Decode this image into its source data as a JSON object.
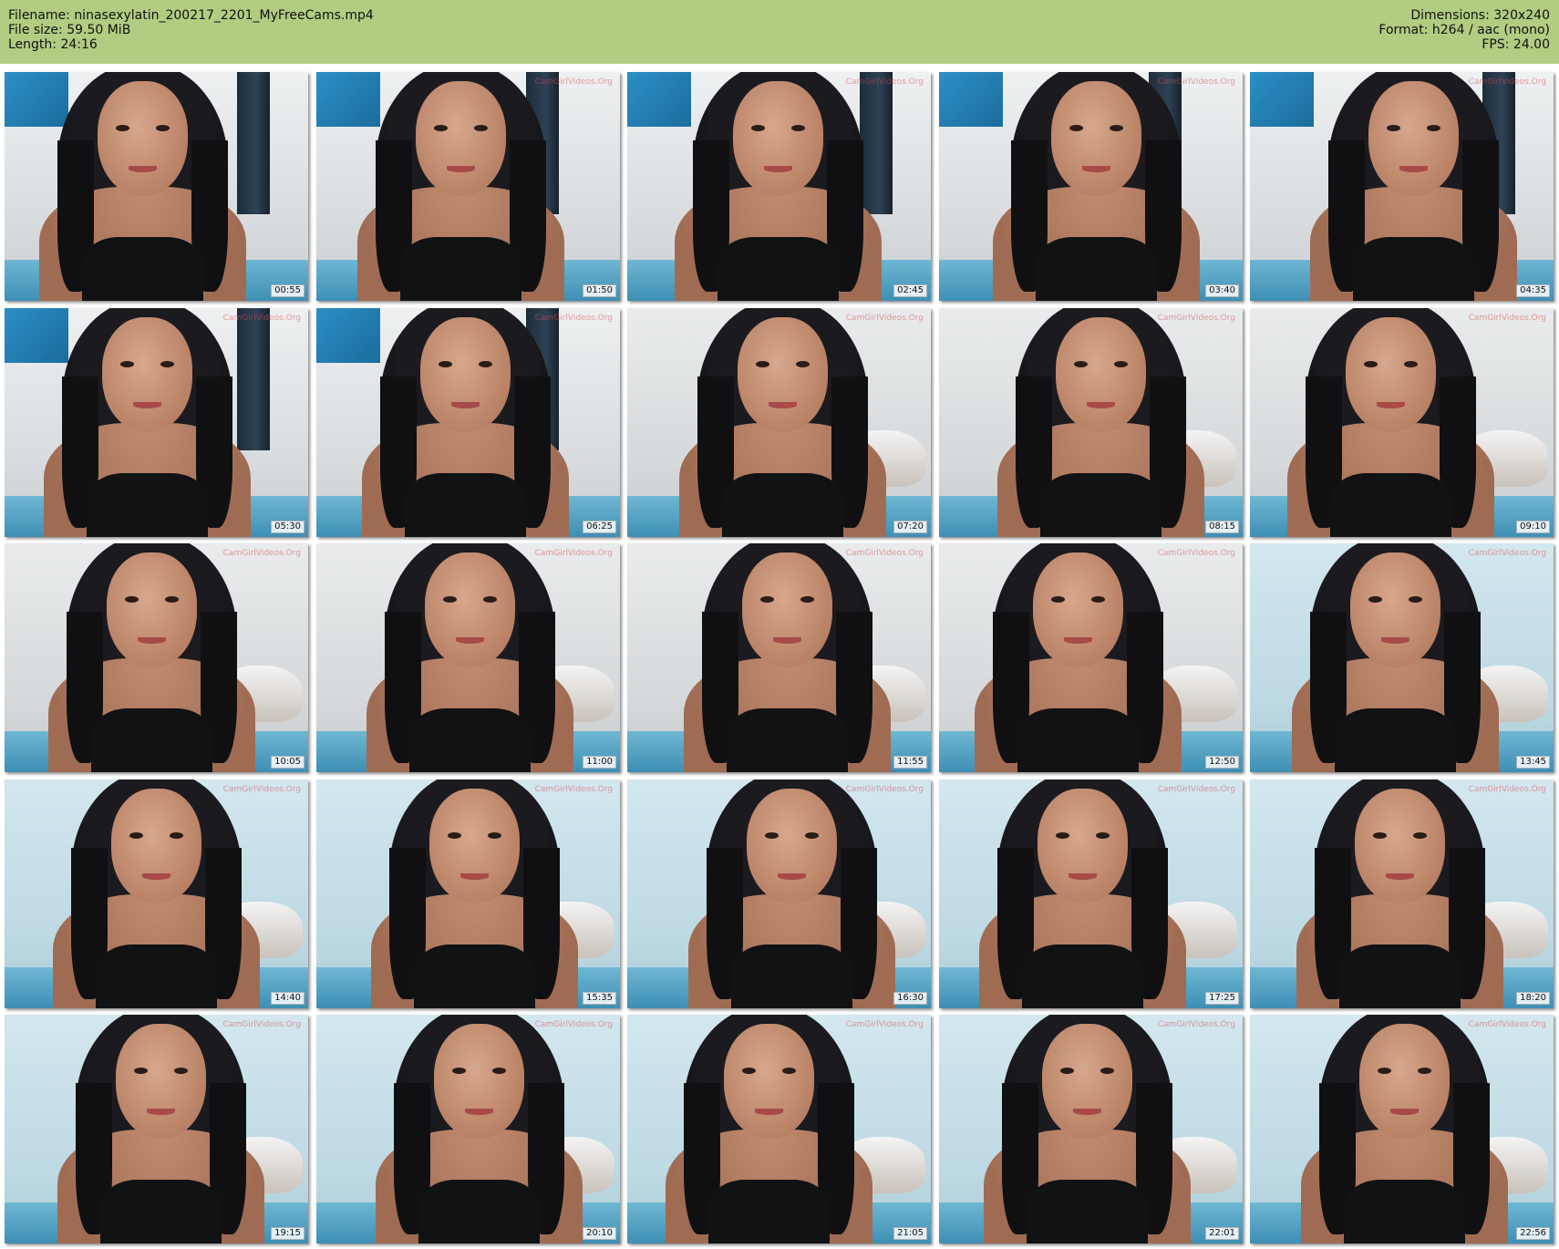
{
  "header": {
    "filename_label": "Filename:",
    "filename": "ninasexylatin_200217_2201_MyFreeCams.mp4",
    "filesize_label": "File size:",
    "filesize": "59.50 MiB",
    "length_label": "Length:",
    "length": "24:16",
    "dimensions_label": "Dimensions:",
    "dimensions": "320x240",
    "format_label": "Format:",
    "format": "h264 / aac (mono)",
    "fps_label": "FPS:",
    "fps": "24.00"
  },
  "watermark": "CamGirlVideos.Org",
  "colors": {
    "header_bg": "#b2cc82",
    "page_bg": "#ffffff"
  },
  "thumbnails": [
    {
      "time": "00:55",
      "scene": "curtain"
    },
    {
      "time": "01:50",
      "scene": "curtain"
    },
    {
      "time": "02:45",
      "scene": "curtain"
    },
    {
      "time": "03:40",
      "scene": "curtain"
    },
    {
      "time": "04:35",
      "scene": "curtain"
    },
    {
      "time": "05:30",
      "scene": "curtain"
    },
    {
      "time": "06:25",
      "scene": "curtain"
    },
    {
      "time": "07:20",
      "scene": "room"
    },
    {
      "time": "08:15",
      "scene": "room"
    },
    {
      "time": "09:10",
      "scene": "room"
    },
    {
      "time": "10:05",
      "scene": "room"
    },
    {
      "time": "11:00",
      "scene": "room"
    },
    {
      "time": "11:55",
      "scene": "room"
    },
    {
      "time": "12:50",
      "scene": "room"
    },
    {
      "time": "13:45",
      "scene": "blue"
    },
    {
      "time": "14:40",
      "scene": "blue"
    },
    {
      "time": "15:35",
      "scene": "blue"
    },
    {
      "time": "16:30",
      "scene": "blue"
    },
    {
      "time": "17:25",
      "scene": "blue"
    },
    {
      "time": "18:20",
      "scene": "blue"
    },
    {
      "time": "19:15",
      "scene": "blue"
    },
    {
      "time": "20:10",
      "scene": "blue"
    },
    {
      "time": "21:05",
      "scene": "blue"
    },
    {
      "time": "22:01",
      "scene": "blue"
    },
    {
      "time": "22:56",
      "scene": "blue"
    }
  ]
}
